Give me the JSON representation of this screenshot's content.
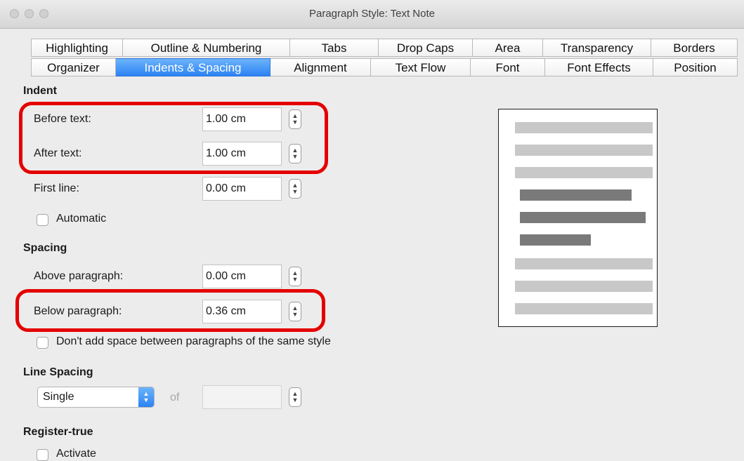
{
  "window": {
    "title": "Paragraph Style: Text Note"
  },
  "tabs": {
    "row1": [
      "Highlighting",
      "Outline & Numbering",
      "Tabs",
      "Drop Caps",
      "Area",
      "Transparency",
      "Borders"
    ],
    "row2": [
      "Organizer",
      "Indents & Spacing",
      "Alignment",
      "Text Flow",
      "Font",
      "Font Effects",
      "Position"
    ],
    "active": "Indents & Spacing"
  },
  "indent": {
    "heading": "Indent",
    "before_text": {
      "label": "Before text:",
      "value": "1.00 cm"
    },
    "after_text": {
      "label": "After text:",
      "value": "1.00 cm"
    },
    "first_line": {
      "label": "First line:",
      "value": "0.00 cm"
    },
    "automatic": {
      "label": "Automatic",
      "checked": false
    }
  },
  "spacing": {
    "heading": "Spacing",
    "above": {
      "label": "Above paragraph:",
      "value": "0.00 cm"
    },
    "below": {
      "label": "Below paragraph:",
      "value": "0.36 cm"
    },
    "no_space_same_style": {
      "label": "Don't add space between paragraphs of the same style",
      "checked": false
    }
  },
  "line_spacing": {
    "heading": "Line Spacing",
    "selected": "Single",
    "of_label": "of",
    "of_value": ""
  },
  "register_true": {
    "heading": "Register-true",
    "activate": {
      "label": "Activate",
      "checked": false
    }
  },
  "colors": {
    "highlight": "#e40000",
    "tab_active": "#2c83f4",
    "preview_context_line": "#c8c8c8",
    "preview_current_line": "#7a7a7a"
  }
}
